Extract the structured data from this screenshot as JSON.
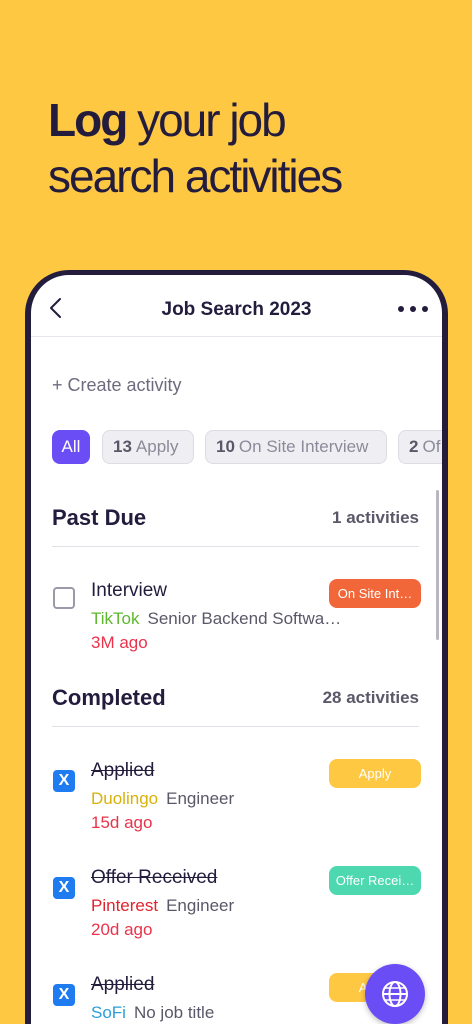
{
  "headline": {
    "bold": "Log",
    "rest_line1": " your job",
    "line2": "search activities"
  },
  "topbar": {
    "title": "Job Search 2023"
  },
  "create_label": "+ Create activity",
  "filters": [
    {
      "count": "",
      "label": "All",
      "active": true
    },
    {
      "count": "13",
      "label": "Apply"
    },
    {
      "count": "10",
      "label": "On Site Interview"
    },
    {
      "count": "2",
      "label": "Of"
    }
  ],
  "sections": {
    "past_due": {
      "title": "Past Due",
      "count": "1 activities",
      "items": [
        {
          "title": "Interview",
          "company": "TikTok",
          "role": "Senior Backend Softwa…",
          "time": "3M ago",
          "tag": "On Site Int…",
          "tag_color": "#F2673A",
          "company_color": "#5DB82E"
        }
      ]
    },
    "completed": {
      "title": "Completed",
      "count": "28 activities",
      "items": [
        {
          "title": "Applied",
          "company": "Duolingo",
          "role": "Engineer",
          "time": "15d ago",
          "tag": "Apply",
          "tag_color": "#FFC843",
          "company_color": "#D8B20A"
        },
        {
          "title": "Offer Received",
          "company": "Pinterest",
          "role": "Engineer",
          "time": "20d ago",
          "tag": "Offer Recei…",
          "tag_color": "#4ED8B0",
          "company_color": "#E0232E"
        },
        {
          "title": "Applied",
          "company": "SoFi",
          "role": "No job title",
          "time": "",
          "tag": "Apply",
          "tag_color": "#FFC843",
          "company_color": "#2A9FD8"
        }
      ]
    }
  },
  "checkbox_mark": "X",
  "icons": {
    "back": "chevron-left-icon",
    "more": "more-horizontal-icon",
    "fab": "globe-icon"
  }
}
